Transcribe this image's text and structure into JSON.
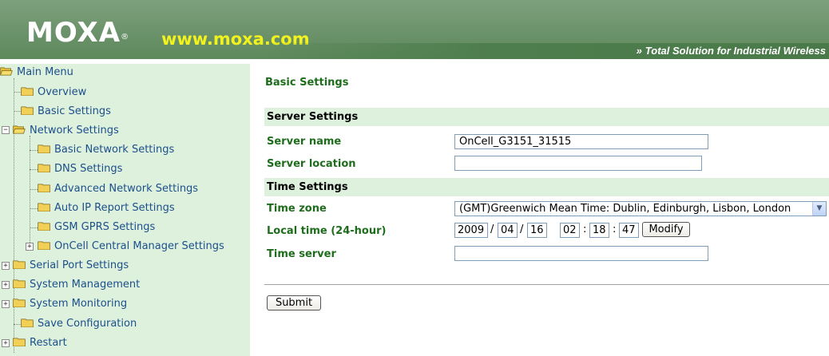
{
  "header": {
    "logo": "MOXA",
    "trademark": "®",
    "url": "www.moxa.com",
    "tagline_chevron": "»",
    "tagline": "Total Solution for Industrial Wireless"
  },
  "sidebar": {
    "root": "Main Menu",
    "items": [
      {
        "label": "Overview"
      },
      {
        "label": "Basic Settings"
      },
      {
        "label": "Network Settings",
        "expanded": true
      },
      {
        "label": "Basic Network Settings"
      },
      {
        "label": "DNS Settings"
      },
      {
        "label": "Advanced Network Settings"
      },
      {
        "label": "Auto IP Report Settings"
      },
      {
        "label": "GSM GPRS Settings"
      },
      {
        "label": "OnCell Central Manager Settings"
      },
      {
        "label": "Serial Port Settings"
      },
      {
        "label": "System Management"
      },
      {
        "label": "System Monitoring"
      },
      {
        "label": "Save Configuration"
      },
      {
        "label": "Restart"
      }
    ],
    "expander_plus": "+",
    "expander_minus": "−"
  },
  "main": {
    "title": "Basic Settings",
    "server_settings": {
      "heading": "Server Settings",
      "server_name_label": "Server name",
      "server_name_value": "OnCell_G3151_31515",
      "server_location_label": "Server location",
      "server_location_value": ""
    },
    "time_settings": {
      "heading": "Time Settings",
      "time_zone_label": "Time zone",
      "time_zone_value": "(GMT)Greenwich Mean Time: Dublin, Edinburgh, Lisbon, London",
      "local_time_label": "Local time (24-hour)",
      "year": "2009",
      "month": "04",
      "day": "16",
      "hour": "02",
      "minute": "18",
      "second": "47",
      "date_sep": "/",
      "time_sep": ":",
      "modify_label": "Modify",
      "time_server_label": "Time server",
      "time_server_value": ""
    },
    "submit_label": "Submit"
  },
  "colors": {
    "header_green": "#6a9169",
    "url_yellow": "#f2f21e",
    "sidebar_bg": "#ddf1dc",
    "label_green": "#1e6d1c",
    "link_blue": "#1d4f8c"
  }
}
